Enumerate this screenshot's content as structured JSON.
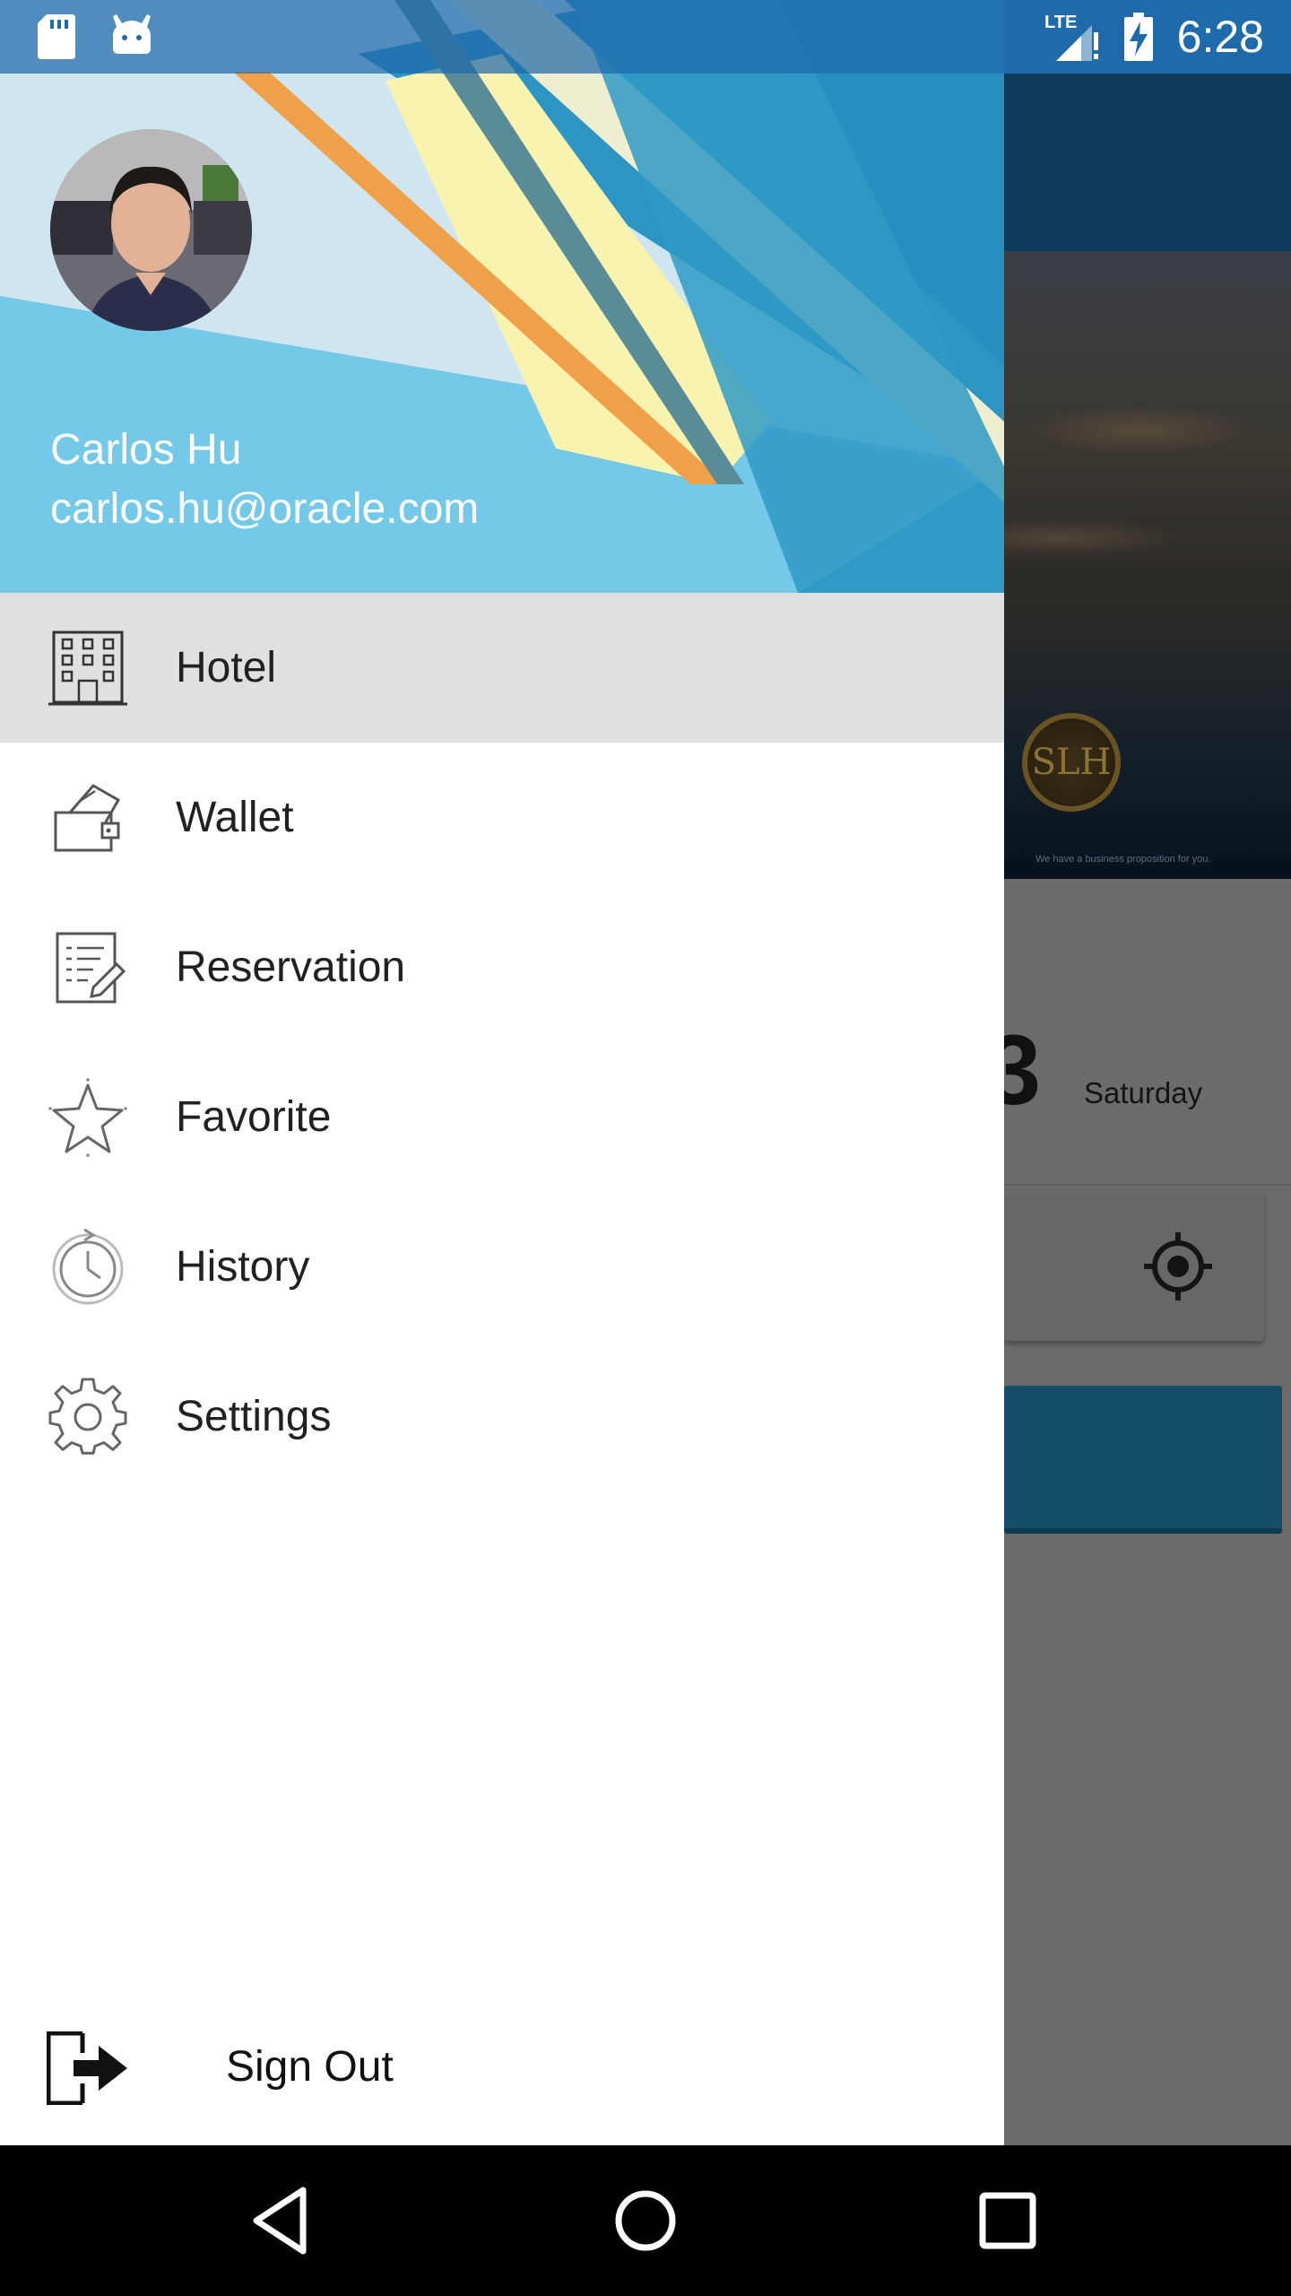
{
  "status_bar": {
    "time": "6:28",
    "network": "LTE",
    "icons": [
      "sd-card-icon",
      "android-debug-icon",
      "signal-icon",
      "battery-charging-icon"
    ]
  },
  "drawer": {
    "user": {
      "name": "Carlos Hu",
      "email": "carlos.hu@oracle.com"
    },
    "items": [
      {
        "label": "Hotel",
        "icon": "hotel-icon",
        "selected": true
      },
      {
        "label": "Wallet",
        "icon": "wallet-icon",
        "selected": false
      },
      {
        "label": "Reservation",
        "icon": "reservation-icon",
        "selected": false
      },
      {
        "label": "Favorite",
        "icon": "star-icon",
        "selected": false
      },
      {
        "label": "History",
        "icon": "history-icon",
        "selected": false
      },
      {
        "label": "Settings",
        "icon": "gear-icon",
        "selected": false
      }
    ],
    "sign_out_label": "Sign Out"
  },
  "background_app": {
    "day_number": "3",
    "day_name": "Saturday",
    "seal_text": "SLH",
    "tagline": "We have a business proposition for you."
  },
  "colors": {
    "status_bar": "#1f6aab",
    "selected_item": "#e0e0e0",
    "scrim": "#6a6a6a"
  }
}
